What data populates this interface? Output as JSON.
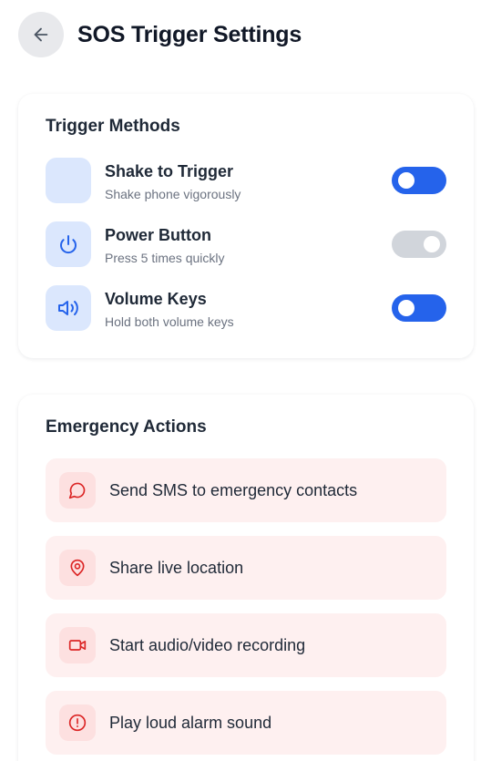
{
  "header": {
    "back_icon": "arrow-left-icon",
    "title": "SOS Trigger Settings"
  },
  "trigger_methods": {
    "title": "Trigger Methods",
    "items": [
      {
        "title": "Shake to Trigger",
        "subtitle": "Shake phone vigorously",
        "icon": "none",
        "toggle_color": "blue"
      },
      {
        "title": "Power Button",
        "subtitle": "Press 5 times quickly",
        "icon": "power-icon",
        "toggle_color": "gray"
      },
      {
        "title": "Volume Keys",
        "subtitle": "Hold both volume keys",
        "icon": "volume-icon",
        "toggle_color": "blue"
      }
    ]
  },
  "emergency_actions": {
    "title": "Emergency Actions",
    "items": [
      {
        "label": "Send SMS to emergency contacts",
        "icon": "message-icon"
      },
      {
        "label": "Share live location",
        "icon": "map-pin-icon"
      },
      {
        "label": "Start audio/video recording",
        "icon": "video-icon"
      },
      {
        "label": "Play loud alarm sound",
        "icon": "alert-circle-icon"
      }
    ]
  },
  "colors": {
    "toggle_blue": "#2563eb",
    "toggle_gray": "#d1d5db",
    "trigger_icon_bg": "#dbe7fd",
    "trigger_icon_stroke": "#2563eb",
    "action_row_bg": "#fef0f0",
    "action_icon_bg": "#fde0e0",
    "action_icon_stroke": "#dc2626"
  }
}
